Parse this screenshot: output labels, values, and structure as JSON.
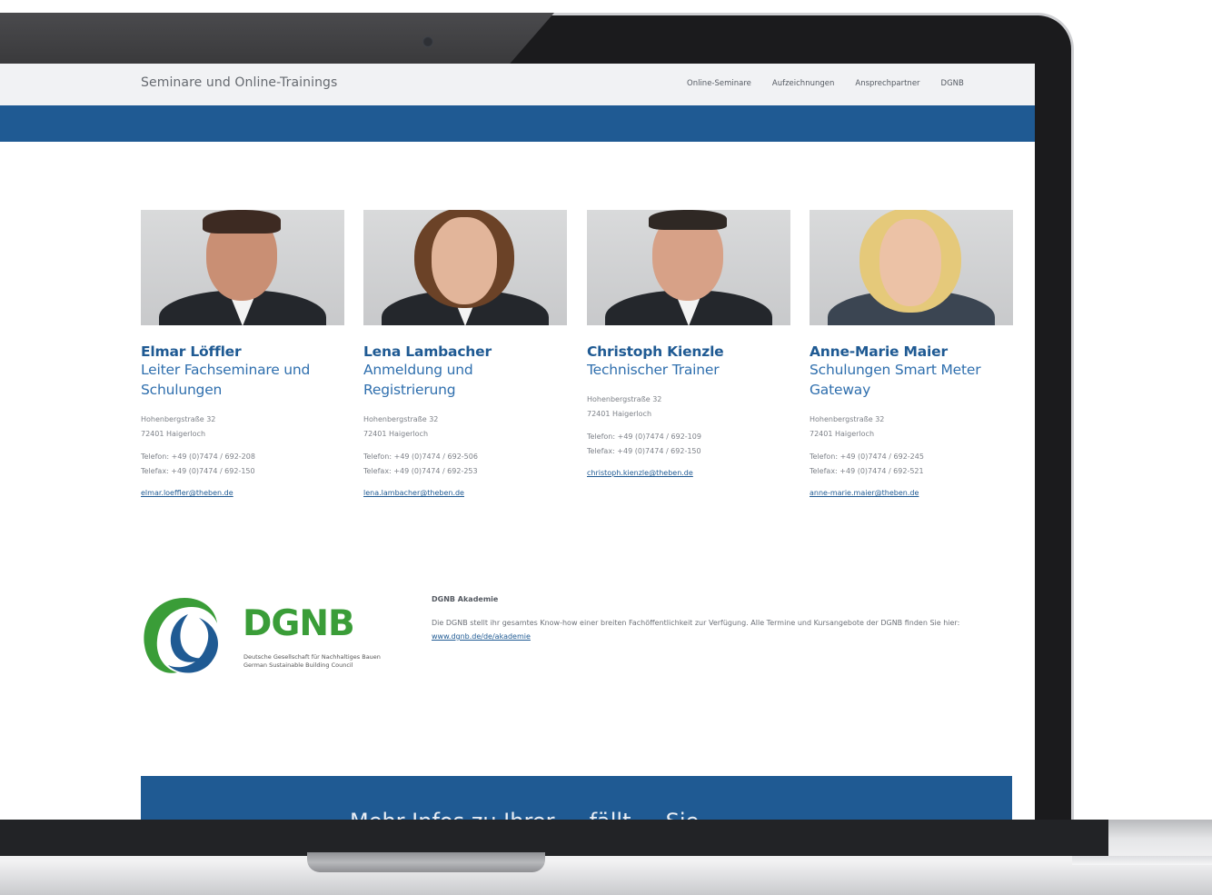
{
  "site": {
    "title": "Seminare und Online-Trainings",
    "nav": [
      "Online-Seminare",
      "Aufzeichnungen",
      "Ansprechpartner",
      "DGNB"
    ]
  },
  "contacts": [
    {
      "name": "Elmar Löffler",
      "role_line1": "Leiter Fachseminare und",
      "role_line2": "Schulungen",
      "street": "Hohenbergstraße 32",
      "city": "72401 Haigerloch",
      "phone": "Telefon: +49 (0)7474 / 692-208",
      "fax": "Telefax: +49 (0)7474 / 692-150",
      "email": "elmar.loeffler@theben.de"
    },
    {
      "name": "Lena Lambacher",
      "role_line1": "Anmeldung und",
      "role_line2": "Registrierung",
      "street": "Hohenbergstraße 32",
      "city": "72401 Haigerloch",
      "phone": "Telefon: +49 (0)7474 / 692-506",
      "fax": "Telefax: +49 (0)7474 / 692-253",
      "email": "lena.lambacher@theben.de"
    },
    {
      "name": "Christoph Kienzle",
      "role_line1": "Technischer Trainer",
      "role_line2": "",
      "street": "Hohenbergstraße 32",
      "city": "72401 Haigerloch",
      "phone": "Telefon: +49 (0)7474 / 692-109",
      "fax": "Telefax: +49 (0)7474 / 692-150",
      "email": "christoph.kienzle@theben.de"
    },
    {
      "name": "Anne-Marie Maier",
      "role_line1": "Schulungen Smart Meter",
      "role_line2": "Gateway",
      "street": "Hohenbergstraße 32",
      "city": "72401 Haigerloch",
      "phone": "Telefon: +49 (0)7474 / 692-245",
      "fax": "Telefax: +49 (0)7474 / 692-521",
      "email": "anne-marie.maier@theben.de"
    }
  ],
  "dgnb": {
    "logo_text": "DGNB",
    "logo_sub1": "Deutsche Gesellschaft für Nachhaltiges Bauen",
    "logo_sub2": "German Sustainable Building Council",
    "title": "DGNB Akademie",
    "text": "Die DGNB stellt ihr gesamtes Know-how einer breiten Fachöffentlichkeit zur Verfügung. Alle Termine und Kursangebote der DGNB finden Sie hier: ",
    "link": "www.dgnb.de/de/akademie"
  },
  "cta": {
    "text": "Mehr Infos zu Ihrer ... fällt ... Sie"
  },
  "colors": {
    "primary": "#1f5a93",
    "accent_green": "#3a9d38",
    "topbar": "#f1f2f4"
  }
}
